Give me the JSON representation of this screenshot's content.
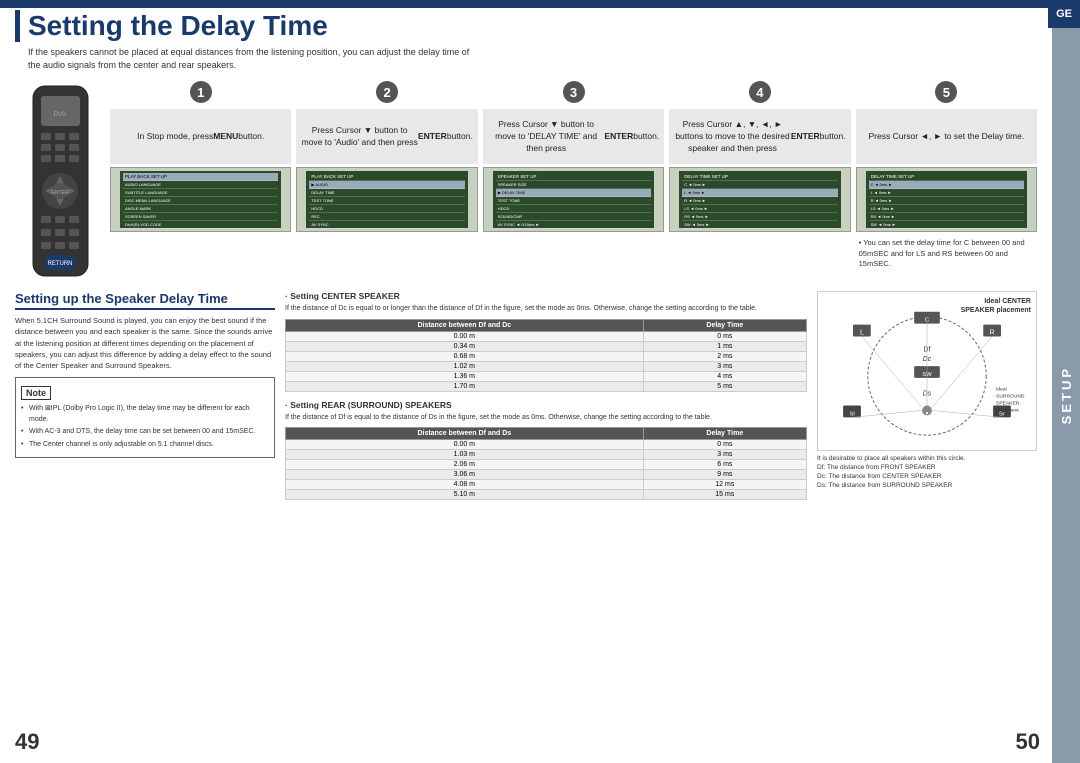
{
  "page": {
    "title": "Setting the Delay Time",
    "subtitle_line1": "If the speakers cannot be placed at equal distances from the listening position, you can adjust the delay time of",
    "subtitle_line2": "the audio signals from the center and rear speakers.",
    "ge_badge": "GE",
    "setup_label": "SETUP",
    "page_left": "49",
    "page_right": "50"
  },
  "steps": [
    {
      "number": "1",
      "text": "In Stop mode, press MENU button.",
      "bold_words": [
        "MENU"
      ]
    },
    {
      "number": "2",
      "text": "Press Cursor ▼ button to move to 'Audio' and then press ENTER button.",
      "bold_words": [
        "ENTER"
      ]
    },
    {
      "number": "3",
      "text": "Press Cursor ▼ button to move to 'DELAY TIME' and then press ENTER button.",
      "bold_words": [
        "ENTER"
      ]
    },
    {
      "number": "4",
      "text": "Press Cursor ▲, ▼, ◄, ► buttons to move to the desired speaker and then press ENTER button.",
      "bold_words": [
        "ENTER"
      ]
    },
    {
      "number": "5",
      "text": "Press Cursor ◄, ► to set the Delay time.",
      "note": "• You can set the delay time for C between 00 and 05mSEC and for LS and RS between 00 and 15mSEC."
    }
  ],
  "bottom": {
    "section_title": "Setting up the Speaker Delay Time",
    "body_text1": "When 5.1CH Surround Sound is played, you can enjoy the best sound if the distance between you and each speaker is the same. Since the sounds arrive at the listening position at different times depending on the placement of speakers, you can adjust this difference by adding a delay effect to the sound of the Center Speaker and Surround Speakers.",
    "note_title": "Note",
    "note_items": [
      "With ⊠IPL (Dolby Pro Logic II), the delay time may be different for each mode.",
      "With AC-3 and DTS, the delay time can be set between 00 and 15mSEC.",
      "The Center channel is only adjustable on 5.1 channel discs."
    ],
    "center_speaker": {
      "title": "· Setting CENTER SPEAKER",
      "text": "If the distance of Dc is equal to or longer than the distance of Df in the figure, set the mode as 0ms. Otherwise, change the setting according to the table.",
      "col1": "Distance between Df and Dc",
      "col2": "Delay Time",
      "rows": [
        [
          "0.00 m",
          "0 ms"
        ],
        [
          "0.34 m",
          "1 ms"
        ],
        [
          "0.68 m",
          "2 ms"
        ],
        [
          "1.02 m",
          "3 ms"
        ],
        [
          "1.36 m",
          "4 ms"
        ],
        [
          "1.70 m",
          "5 ms"
        ]
      ]
    },
    "rear_speaker": {
      "title": "· Setting REAR (SURROUND) SPEAKERS",
      "text": "If the distance of Df is equal to the distance of Ds in the figure, set the mode as 0ms. Otherwise, change the setting according to the table.",
      "col1": "Distance between Df and Ds",
      "col2": "Delay Time",
      "rows": [
        [
          "0.00 m",
          "0 ms"
        ],
        [
          "1.03 m",
          "3 ms"
        ],
        [
          "2.06 m",
          "6 ms"
        ],
        [
          "3.06 m",
          "9 ms"
        ],
        [
          "4.08 m",
          "12 ms"
        ],
        [
          "5.10 m",
          "15 ms"
        ]
      ]
    },
    "diagram": {
      "title_line1": "Ideal CENTER",
      "title_line2": "SPEAKER placement",
      "note": "It is desirable to place all speakers within this circle.\nDf: The distance from FRONT SPEAKER\nDc: The distance from CENTER SPEAKER\nDs: The distance from SURROUND SPEAKER",
      "surround_label_line1": "Ideal",
      "surround_label_line2": "SURROUND",
      "surround_label_line3": "SPEAKER",
      "surround_label_line4": "placement"
    }
  }
}
